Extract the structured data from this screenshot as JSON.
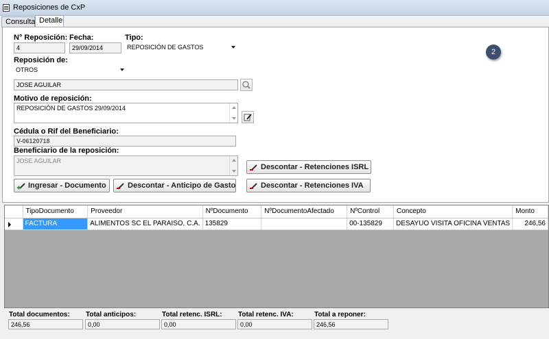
{
  "window": {
    "title": "Reposiciones de CxP"
  },
  "tabs": [
    "Consulta",
    "Detalle"
  ],
  "badge": "2",
  "form": {
    "nro_label": "N° Reposición:",
    "nro_value": "4",
    "fecha_label": "Fecha:",
    "fecha_value": "29/09/2014",
    "tipo_label": "Tipo:",
    "tipo_value": "REPOSICIÓN DE GASTOS",
    "reposicion_de_label": "Reposición de:",
    "reposicion_de_value": "OTROS",
    "persona_value": "JOSE AGUILAR",
    "motivo_label": "Motivo de reposición:",
    "motivo_value": "REPOSICIÓN DE GASTOS 29/09/2014",
    "cedula_label": "Cédula o Rif del Beneficiario:",
    "cedula_value": "V-06120718",
    "beneficiario_label": "Beneficiario de la reposición:",
    "beneficiario_value": "JOSE AGUILAR"
  },
  "buttons": {
    "ingresar": "Ingresar - Documento",
    "anticipo": "Descontar - Anticipo de Gasto",
    "islr": "Descontar - Retenciones ISRL",
    "iva": "Descontar - Retenciones IVA"
  },
  "table": {
    "columns": [
      "TipoDocumento",
      "Proveedor",
      "NºDocumento",
      "NºDocumentoAfectado",
      "NºControl",
      "Concepto",
      "Monto"
    ],
    "rows": [
      [
        "FACTURA",
        "ALIMENTOS SC EL PARAISO, C.A.",
        "135829",
        "",
        "00-135829",
        "DESAYUO VISITA OFICINA VENTAS",
        "246,56"
      ]
    ]
  },
  "totals": [
    {
      "label": "Total documentos:",
      "value": "246,56"
    },
    {
      "label": "Total anticipos:",
      "value": "0,00"
    },
    {
      "label": "Total retenc. ISRL:",
      "value": "0,00"
    },
    {
      "label": "Total retenc. IVA:",
      "value": "0,00"
    },
    {
      "label": "Total a reponer:",
      "value": "246,56"
    }
  ],
  "colors": {
    "selection": "#3399ff",
    "grid_empty": "#a9a9a9",
    "badge": "#3d4f6e"
  }
}
